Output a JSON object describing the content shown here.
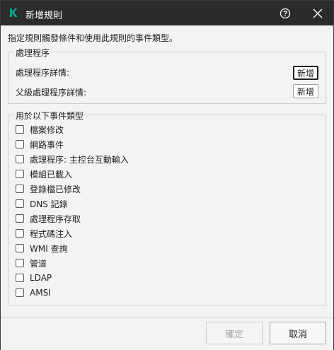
{
  "window": {
    "title": "新增規則",
    "help_icon": "help-circle-icon",
    "close_icon": "close-icon",
    "logo_icon": "kaspersky-k-logo"
  },
  "description": "指定規則觸發條件和使用此規則的事件類型。",
  "process_group": {
    "title": "處理程序",
    "rows": [
      {
        "label": "處理程序詳情:",
        "button": "新增"
      },
      {
        "label": "父級處理程序詳情:",
        "button": "新增"
      }
    ]
  },
  "event_group": {
    "title": "用於以下事件類型",
    "items": [
      {
        "label": "檔案修改",
        "checked": false
      },
      {
        "label": "網路事件",
        "checked": false
      },
      {
        "label": "處理程序: 主控台互動輸入",
        "checked": false
      },
      {
        "label": "模組已載入",
        "checked": false
      },
      {
        "label": "登錄檔已修改",
        "checked": false
      },
      {
        "label": "DNS 記錄",
        "checked": false
      },
      {
        "label": "處理程序存取",
        "checked": false
      },
      {
        "label": "程式碼注入",
        "checked": false
      },
      {
        "label": "WMI 查詢",
        "checked": false
      },
      {
        "label": "管道",
        "checked": false
      },
      {
        "label": "LDAP",
        "checked": false
      },
      {
        "label": "AMSI",
        "checked": false
      }
    ]
  },
  "footer": {
    "ok_label": "確定",
    "cancel_label": "取消"
  },
  "colors": {
    "titlebar": "#2b2b2b",
    "background": "#f3f3f3",
    "logo_green": "#00a88e"
  }
}
